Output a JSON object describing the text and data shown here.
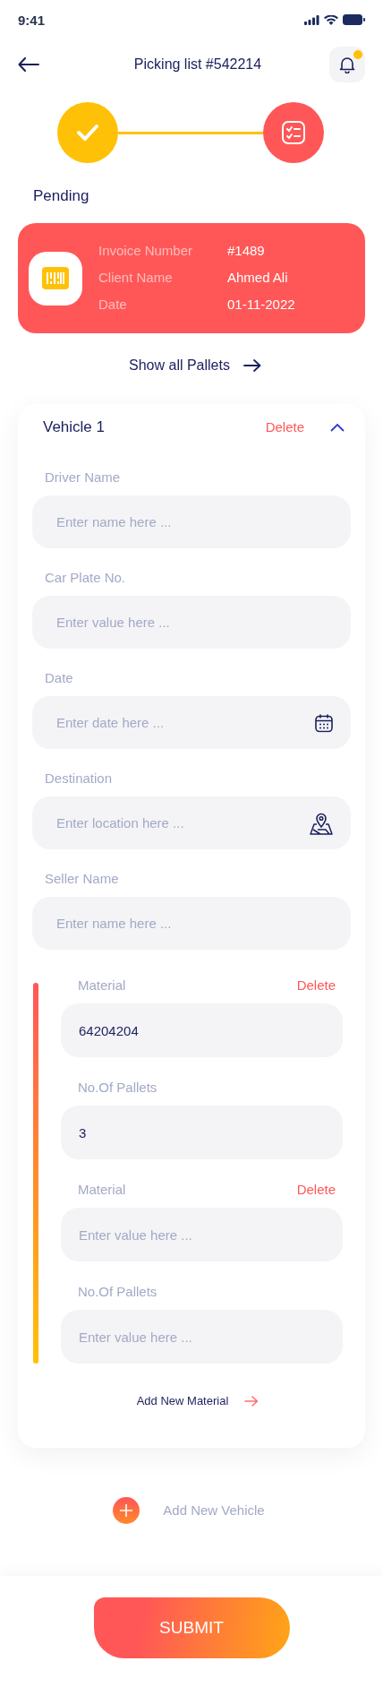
{
  "status_bar": {
    "time": "9:41"
  },
  "header": {
    "title": "Picking list #542214",
    "notification": true
  },
  "steps": [
    {
      "kind": "done"
    },
    {
      "kind": "current"
    }
  ],
  "status_label": "Pending",
  "invoice": [
    {
      "label": "Invoice Number",
      "value": "#1489"
    },
    {
      "label": "Client Name",
      "value": "Ahmed Ali"
    },
    {
      "label": "Date",
      "value": "01-11-2022"
    }
  ],
  "show_all": "Show all Pallets",
  "vehicles": [
    {
      "title": "Vehicle 1",
      "delete": "Delete",
      "expanded": true,
      "fields": [
        {
          "kind": "text",
          "label": "Driver Name",
          "placeholder": "Enter name here ..."
        },
        {
          "kind": "text",
          "label": "Car Plate No.",
          "placeholder": "Enter value here ..."
        },
        {
          "kind": "date",
          "label": "Date",
          "placeholder": "Enter date here ..."
        },
        {
          "kind": "location",
          "label": "Destination",
          "placeholder": "Enter location here ..."
        },
        {
          "kind": "text",
          "label": "Seller Name",
          "placeholder": "Enter name here ..."
        }
      ],
      "materials": [
        {
          "label": "Material",
          "delete": "Delete",
          "value": "64204204",
          "pallets_label": "No.Of Pallets",
          "pallets_value": "3"
        },
        {
          "label": "Material",
          "delete": "Delete",
          "placeholder": "Enter value here ...",
          "pallets_label": "No.Of Pallets",
          "pallets_placeholder": "Enter value here ..."
        }
      ],
      "add_material": "Add New Material"
    }
  ],
  "add_vehicle": "Add New Vehicle",
  "submit": "SUBMIT"
}
